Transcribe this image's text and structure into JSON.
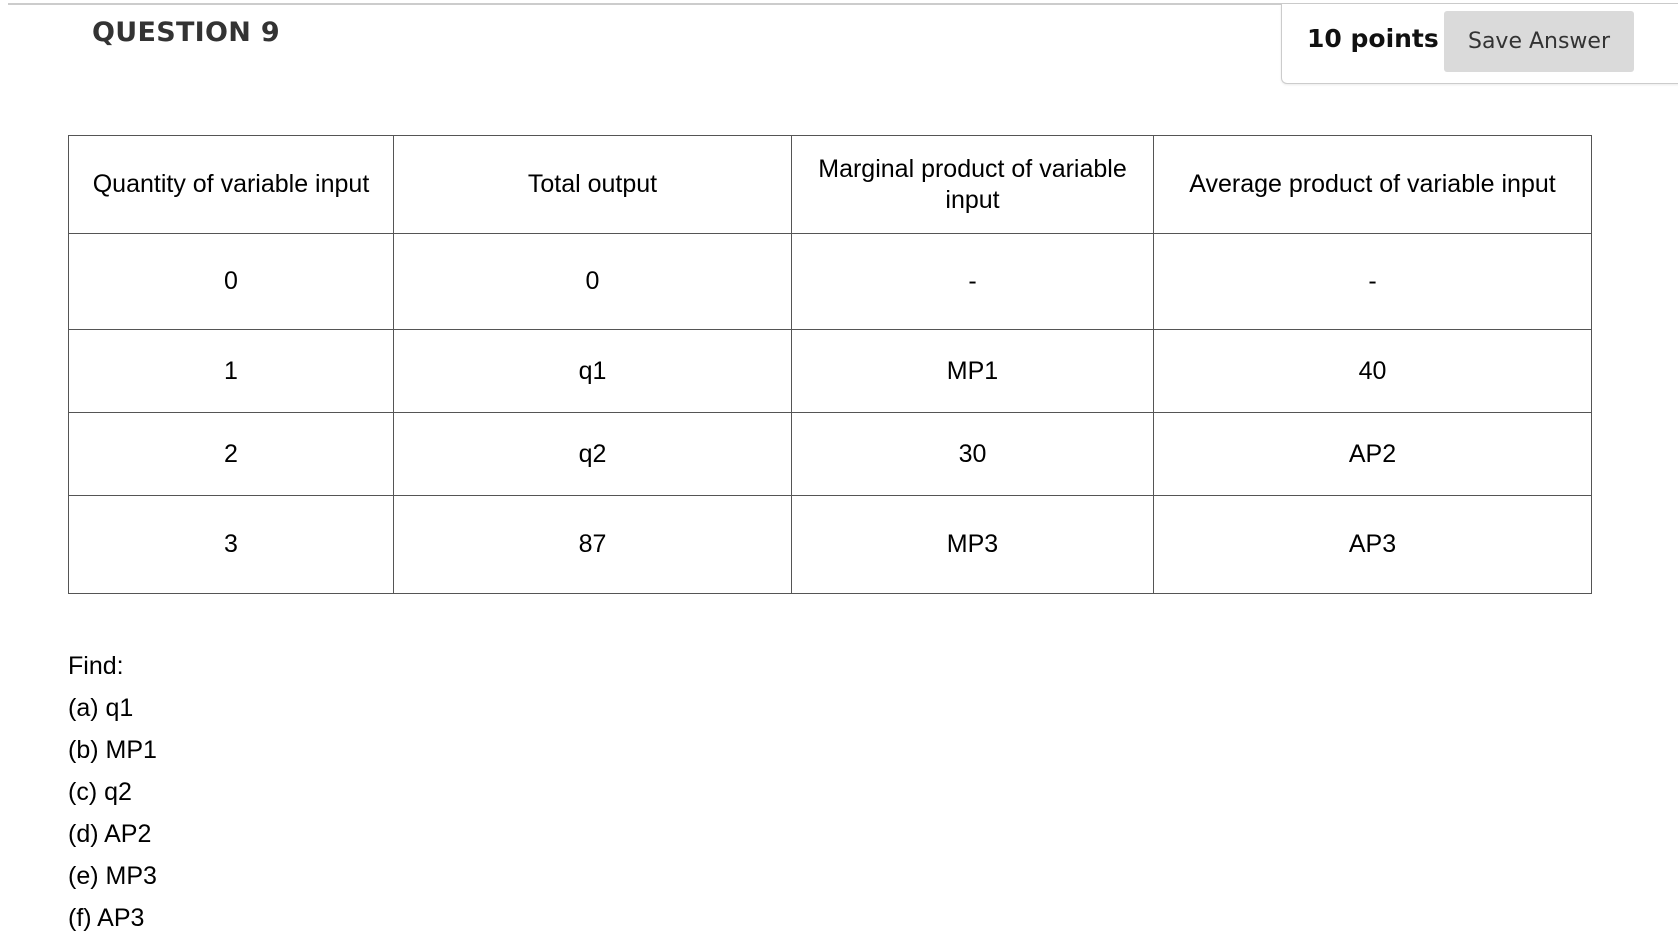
{
  "question": {
    "title": "QUESTION 9",
    "points": "10 points",
    "save_label": "Save Answer"
  },
  "table": {
    "headers": [
      "Quantity of variable input",
      "Total output",
      "Marginal product of variable input",
      "Average product of variable input"
    ],
    "rows": [
      [
        "0",
        "0",
        "-",
        "-"
      ],
      [
        "1",
        "q1",
        "MP1",
        "40"
      ],
      [
        "2",
        "q2",
        "30",
        "AP2"
      ],
      [
        "3",
        "87",
        "MP3",
        "AP3"
      ]
    ]
  },
  "find": {
    "label": "Find:",
    "items": [
      "(a) q1",
      "(b) MP1",
      "(c) q2",
      "(d) AP2",
      "(e) MP3",
      "(f) AP3"
    ]
  }
}
